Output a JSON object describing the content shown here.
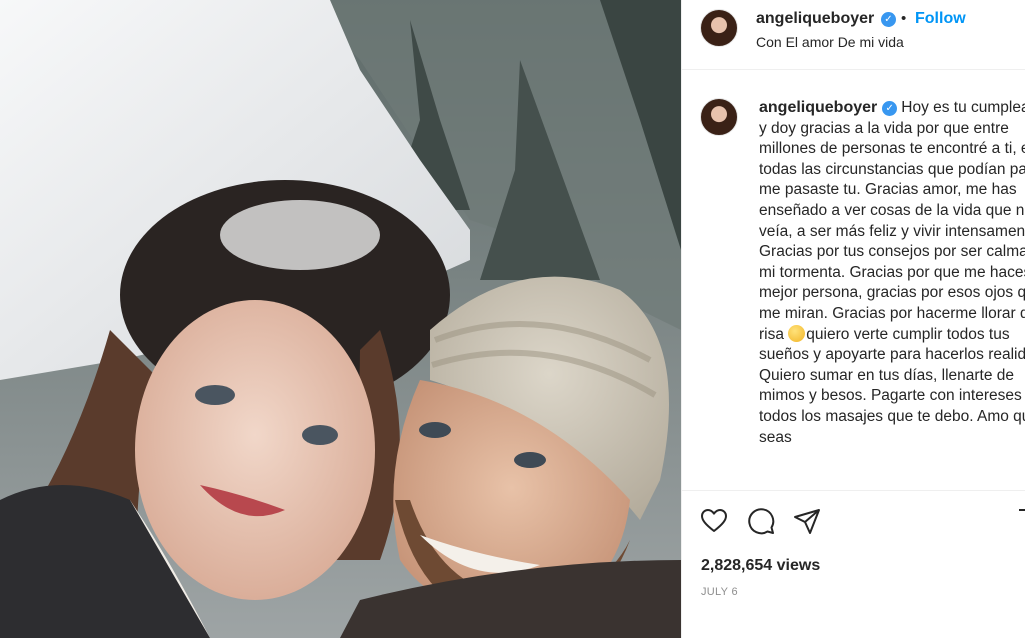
{
  "post": {
    "author": {
      "username": "angeliqueboyer",
      "verified": true,
      "verified_icon": "verified-badge-icon"
    },
    "follow_label": "Follow",
    "separator": "•",
    "location": "Con El amor De mi vida",
    "caption": {
      "username": "angeliqueboyer",
      "text_part1": "Hoy es tu cumpleaños y doy gracias a la vida por que entre millones de personas te encontré a ti, entre todas las circunstancias que podían pasar, me pasaste tu. Gracias amor, me has enseñado a ver cosas de la vida que no veía, a ser más feliz y vivir intensamente. Gracias por tus consejos por ser calma en mi tormenta. Gracias por que me haces mejor persona, gracias por esos ojos que me miran. Gracias por hacerme llorar de la risa ",
      "emoji": "emoji-face",
      "text_part2": "quiero verte cumplir todos tus sueños y apoyarte para hacerlos realidad. Quiero sumar en tus días, llenarte de mimos y besos. Pagarte con intereses todos los masajes que te debo. Amo que seas"
    },
    "actions": {
      "like_icon": "heart-icon",
      "comment_icon": "comment-icon",
      "share_icon": "share-icon"
    },
    "views": "2,828,654 views",
    "date": "JULY 6"
  },
  "media": {
    "description_icon": "photo-couple-snow"
  },
  "colors": {
    "link_blue": "#0095f6",
    "verified_blue": "#3897f0",
    "text": "#262626",
    "muted": "#8e8e8e",
    "border": "#efefef"
  }
}
